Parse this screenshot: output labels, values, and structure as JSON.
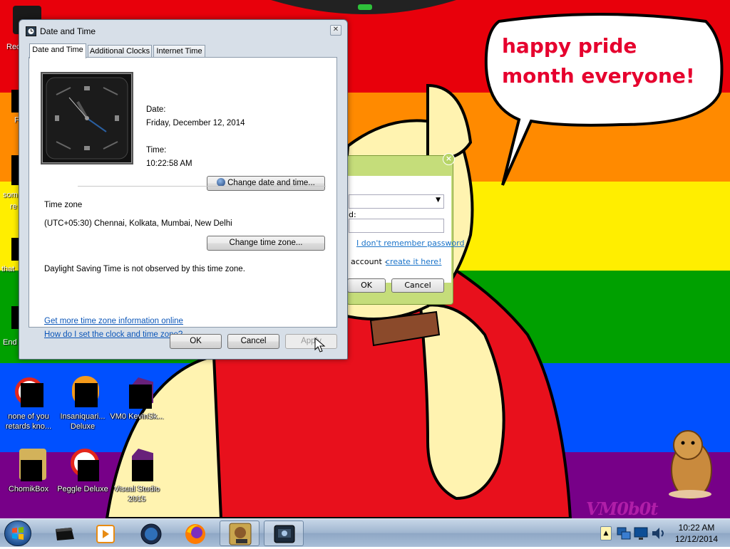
{
  "wallpaper": {
    "speech_bubble_text": "happy pride month everyone!",
    "watermark": "VM0b0t",
    "colors": {
      "red": "#e8000b",
      "orange": "#ff8a00",
      "yellow": "#ffee00",
      "green": "#00a000",
      "blue": "#0050ff",
      "purple": "#770088"
    }
  },
  "desktop_icons": [
    {
      "label": "none of you retards kno...",
      "icon": "pinball-icon"
    },
    {
      "label": "Insaniquari... Deluxe",
      "icon": "fish-game-icon"
    },
    {
      "label": "VM0 KevinSk...",
      "icon": "visual-studio-icon"
    },
    {
      "label": "ChomikBox",
      "icon": "chomikbox-icon"
    },
    {
      "label": "Peggle Deluxe",
      "icon": "peggle-icon"
    },
    {
      "label": "Visual Studio 2015",
      "icon": "visual-studio-icon"
    }
  ],
  "edge_labels": [
    "Rec",
    "F",
    "som",
    "re",
    "that",
    "End"
  ],
  "login_window": {
    "field_label": "d:",
    "forgot_password_link": "I don't remember password",
    "account_text": "account -",
    "create_account_link": "create it here!",
    "ok_label": "OK",
    "cancel_label": "Cancel",
    "close_glyph": "×"
  },
  "dialog": {
    "title": "Date and Time",
    "close_glyph": "✕",
    "tabs": [
      {
        "label": "Date and Time",
        "active": true
      },
      {
        "label": "Additional Clocks",
        "active": false
      },
      {
        "label": "Internet Time",
        "active": false
      }
    ],
    "date_label": "Date:",
    "date_value": "Friday, December 12, 2014",
    "time_label": "Time:",
    "time_value": "10:22:58 AM",
    "change_date_time_button": "Change date and time...",
    "time_zone_heading": "Time zone",
    "time_zone_value": "(UTC+05:30) Chennai, Kolkata, Mumbai, New Delhi",
    "change_time_zone_button": "Change time zone...",
    "dst_text": "Daylight Saving Time is not observed by this time zone.",
    "link_more_info": "Get more time zone information online",
    "link_how_set": "How do I set the clock and time zone?",
    "ok_button": "OK",
    "cancel_button": "Cancel",
    "apply_button": "Apply",
    "apply_enabled": false
  },
  "taskbar": {
    "pinned": [
      "start-orb",
      "blackbox-icon",
      "media-player-icon",
      "globe-icon",
      "firefox-icon",
      "chomikbox-icon",
      "date-time-app-icon"
    ],
    "clock_time": "10:22 AM",
    "clock_date": "12/12/2014"
  }
}
